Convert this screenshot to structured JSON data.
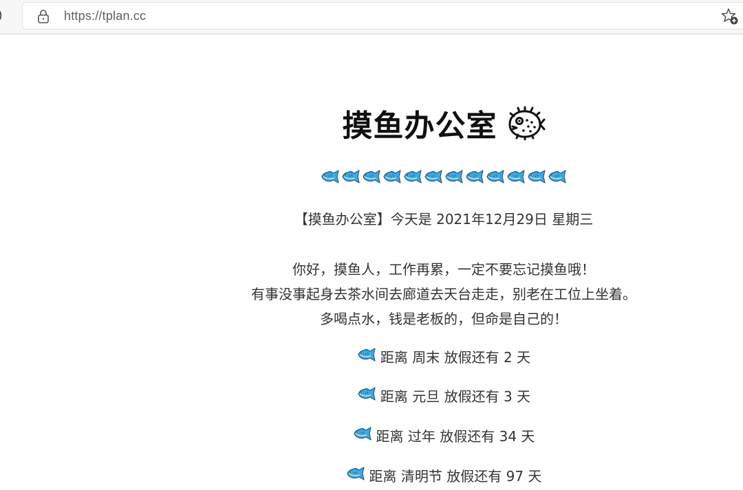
{
  "browser": {
    "url": "https://tplan.cc",
    "edge_glyph": ")"
  },
  "page": {
    "title": "摸鱼办公室",
    "fish_count": 12,
    "date_line": "【摸鱼办公室】今天是 2021年12月29日 星期三",
    "greeting_lines": [
      "你好，摸鱼人，工作再累，一定不要忘记摸鱼哦！",
      "有事没事起身去茶水间去廊道去天台走走，别老在工位上坐着。",
      "多喝点水，钱是老板的，但命是自己的！"
    ],
    "countdowns": [
      {
        "text": "距离 周末 放假还有 2 天"
      },
      {
        "text": "距离 元旦 放假还有 3 天"
      },
      {
        "text": "距离 过年 放假还有 34 天"
      },
      {
        "text": "距离 清明节 放假还有 97 天"
      }
    ]
  },
  "icons": {
    "lock": "lock-icon",
    "favorite": "add-favorite-icon",
    "fish": "fish-icon",
    "title_fish": "blowfish-icon"
  }
}
